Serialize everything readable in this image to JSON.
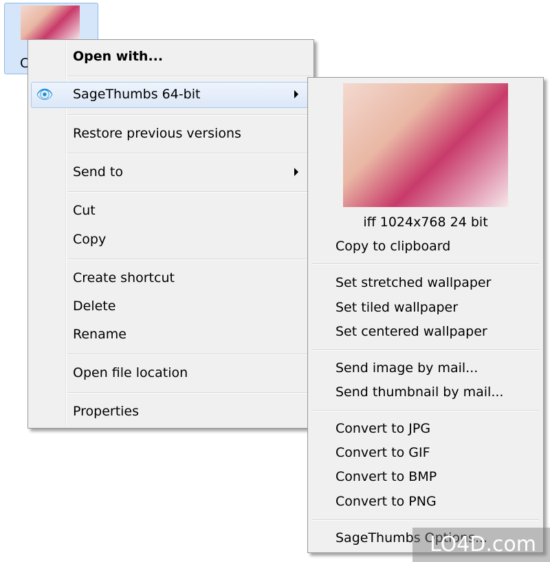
{
  "desktop": {
    "file_label": "C"
  },
  "context_menu": {
    "items": [
      "Open with...",
      "SageThumbs 64-bit",
      "Restore previous versions",
      "Send to",
      "Cut",
      "Copy",
      "Create shortcut",
      "Delete",
      "Rename",
      "Open file location",
      "Properties"
    ]
  },
  "submenu": {
    "image_info": "iff 1024x768 24 bit",
    "items": [
      "Copy to clipboard",
      "Set stretched wallpaper",
      "Set tiled wallpaper",
      "Set centered wallpaper",
      "Send image by mail...",
      "Send thumbnail by mail...",
      "Convert to JPG",
      "Convert to GIF",
      "Convert to BMP",
      "Convert to PNG",
      "SageThumbs Options..."
    ]
  },
  "watermark": "LO4D.com",
  "colors": {
    "highlight": "#dce8f8",
    "menu_bg": "#f0f0f0"
  }
}
